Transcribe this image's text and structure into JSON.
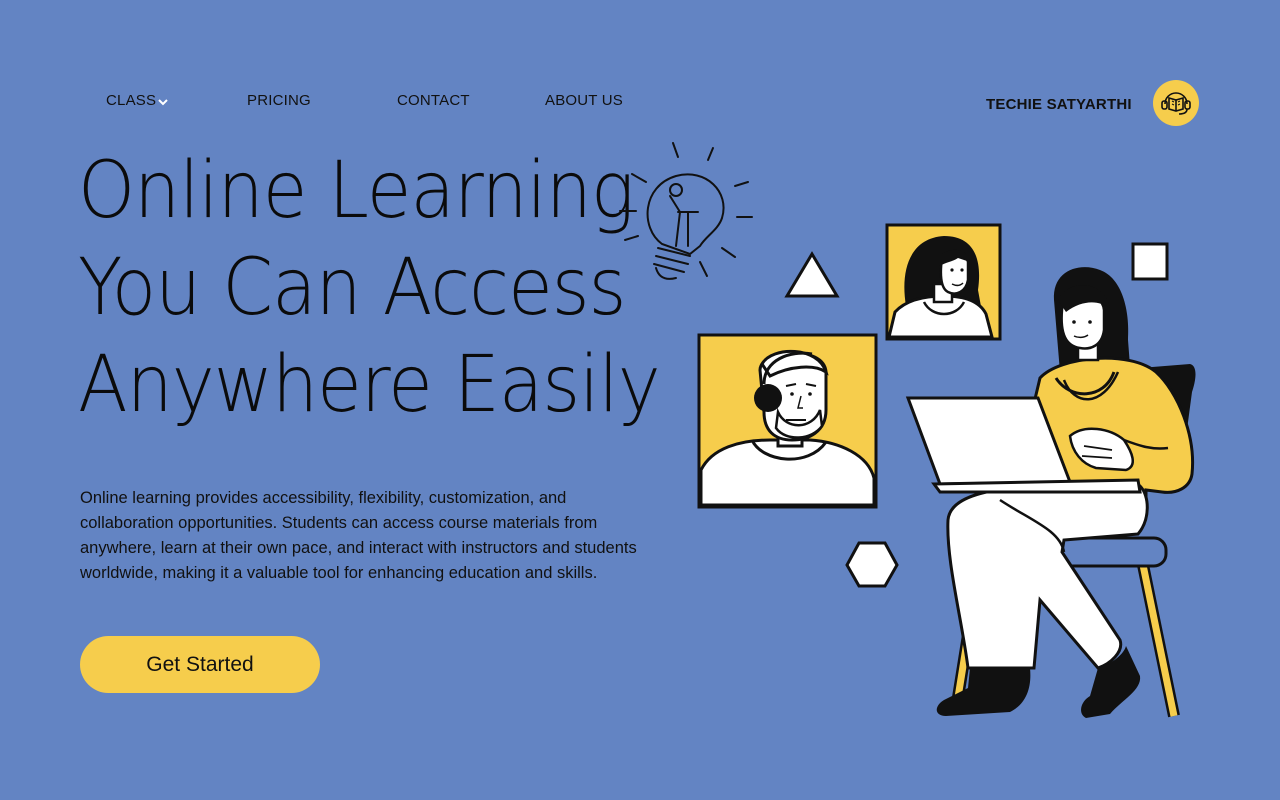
{
  "nav": {
    "items": [
      {
        "label": "CLASS",
        "has_dropdown": true
      },
      {
        "label": "PRICING"
      },
      {
        "label": "CONTACT"
      },
      {
        "label": "ABOUT US"
      }
    ]
  },
  "brand": {
    "name": "TECHIE SATYARTHI",
    "logo_icon": "headset-book-icon"
  },
  "hero": {
    "headline_lines": [
      "Online Learning",
      "You Can Access",
      "Anywhere Easily"
    ],
    "description": "Online learning provides accessibility, flexibility, customization, and collaboration opportunities. Students can access course materials from anywhere, learn at their own pace, and interact with instructors and students worldwide, making it a valuable tool for enhancing education and skills.",
    "cta_label": "Get Started"
  },
  "illustration": {
    "icons": [
      "lightbulb-icon",
      "triangle-icon",
      "square-icon",
      "hexagon-icon",
      "man-avatar-icon",
      "woman-avatar-icon",
      "woman-laptop-icon"
    ]
  },
  "colors": {
    "background": "#6384c3",
    "accent": "#f6cd4c",
    "ink": "#111111",
    "white": "#ffffff"
  }
}
